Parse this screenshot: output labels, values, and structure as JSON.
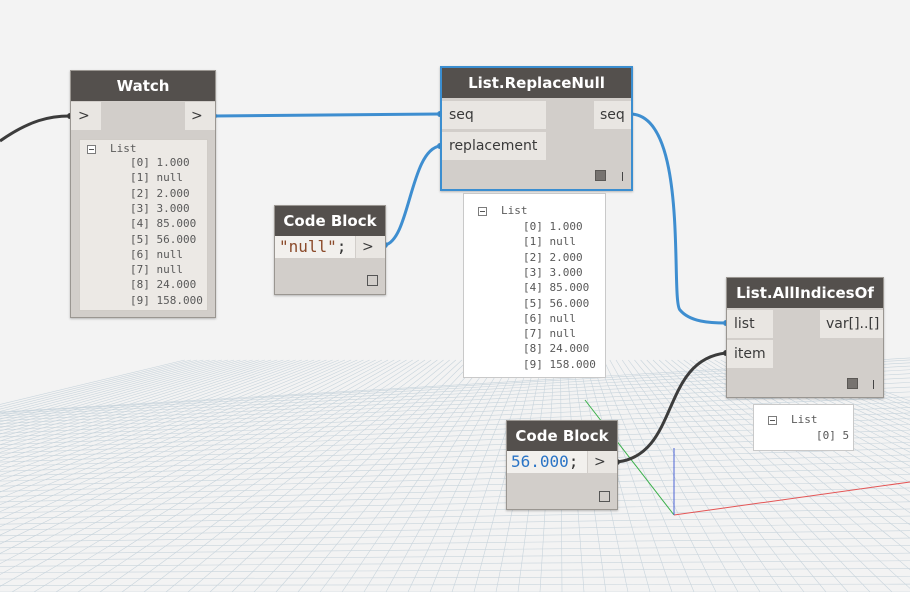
{
  "nodes": {
    "watch": {
      "title": "Watch",
      "input_label": ">",
      "output_label": ">",
      "list_header": "List",
      "items": [
        {
          "index": "[0]",
          "value": "1.000"
        },
        {
          "index": "[1]",
          "value": "null"
        },
        {
          "index": "[2]",
          "value": "2.000"
        },
        {
          "index": "[3]",
          "value": "3.000"
        },
        {
          "index": "[4]",
          "value": "85.000"
        },
        {
          "index": "[5]",
          "value": "56.000"
        },
        {
          "index": "[6]",
          "value": "null"
        },
        {
          "index": "[7]",
          "value": "null"
        },
        {
          "index": "[8]",
          "value": "24.000"
        },
        {
          "index": "[9]",
          "value": "158.000"
        }
      ]
    },
    "replace_null": {
      "title": "List.ReplaceNull",
      "inputs": [
        "seq",
        "replacement"
      ],
      "output": "seq",
      "preview_header": "List",
      "preview_items": [
        {
          "index": "[0]",
          "value": "1.000"
        },
        {
          "index": "[1]",
          "value": "null"
        },
        {
          "index": "[2]",
          "value": "2.000"
        },
        {
          "index": "[3]",
          "value": "3.000"
        },
        {
          "index": "[4]",
          "value": "85.000"
        },
        {
          "index": "[5]",
          "value": "56.000"
        },
        {
          "index": "[6]",
          "value": "null"
        },
        {
          "index": "[7]",
          "value": "null"
        },
        {
          "index": "[8]",
          "value": "24.000"
        },
        {
          "index": "[9]",
          "value": "158.000"
        }
      ]
    },
    "code_block_null": {
      "title": "Code Block",
      "code_value": "\"null\"",
      "code_terminator": ";",
      "output_label": ">"
    },
    "all_indices_of": {
      "title": "List.AllIndicesOf",
      "inputs": [
        "list",
        "item"
      ],
      "output": "var[]..[]",
      "preview_header": "List",
      "preview_items": [
        {
          "index": "[0]",
          "value": "5"
        }
      ]
    },
    "code_block_number": {
      "title": "Code Block",
      "code_value": "56.000",
      "code_terminator": ";",
      "output_label": ">"
    }
  },
  "colors": {
    "wire_active": "#3e8ed0",
    "wire_default": "#3c3c3c",
    "node_header": "#54504d",
    "node_body": "#d2ceca",
    "string_literal": "#8b4a2a",
    "number_literal": "#2a74c6",
    "grid_line": "#c8d4dc",
    "axis_x": "#e45555",
    "axis_y": "#3bb04a",
    "axis_z": "#4b63d6"
  }
}
